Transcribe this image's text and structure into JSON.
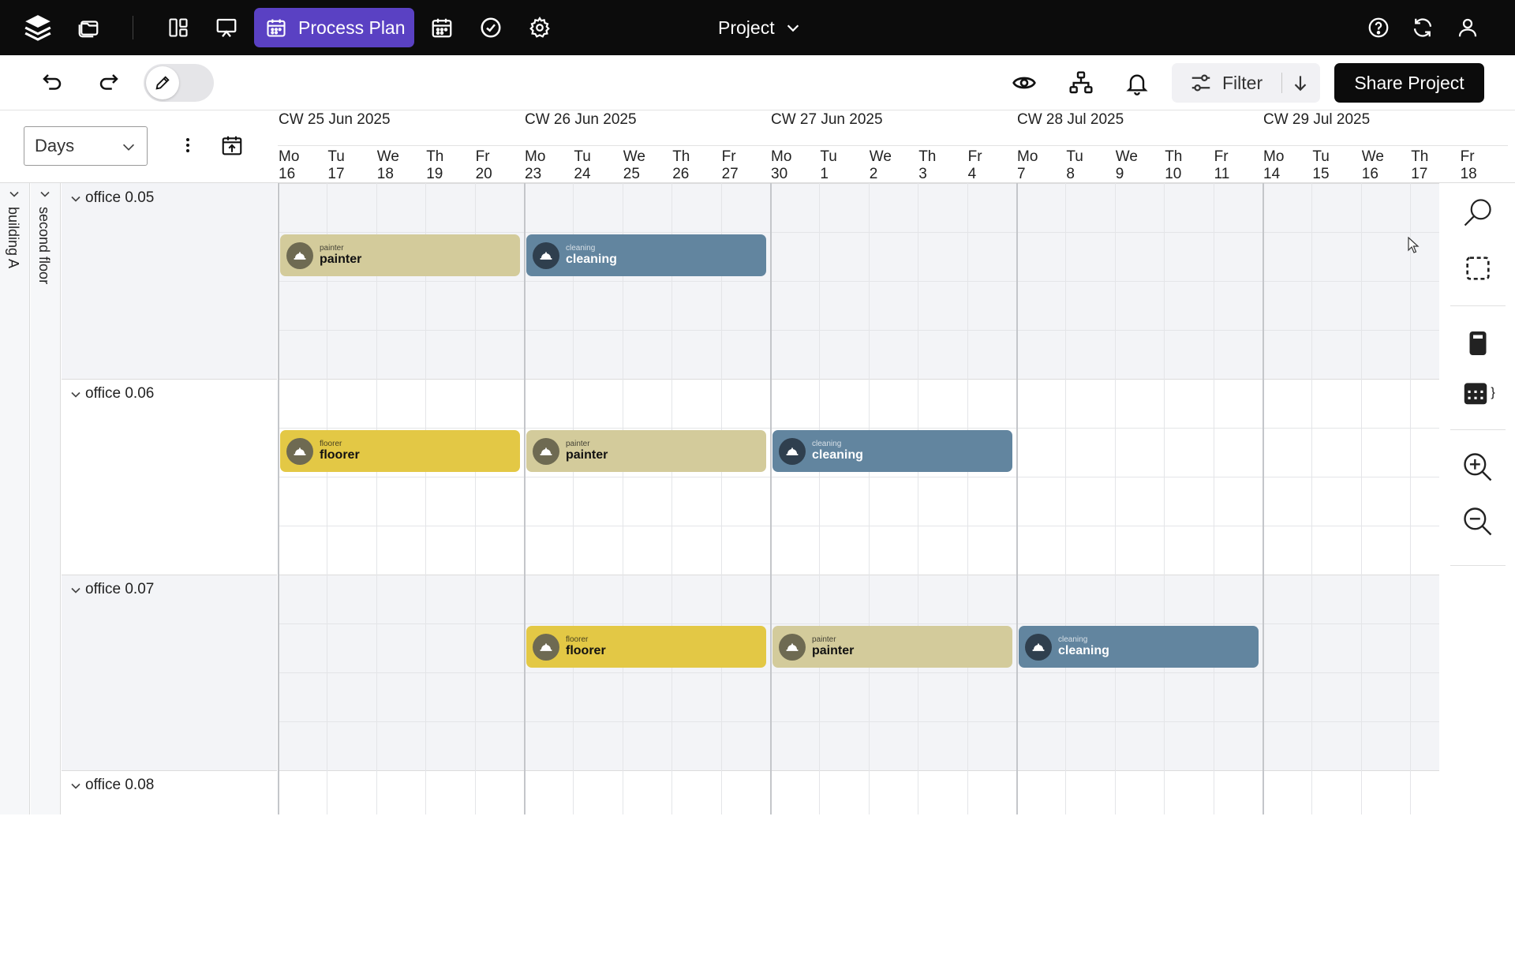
{
  "topbar": {
    "icons": [
      "layers-icon",
      "folder-icon",
      "dashboard-icon",
      "presentation-icon",
      "calendar-icon",
      "check-circle-icon",
      "gear-icon"
    ],
    "active_button": "Process Plan",
    "project_label": "Project",
    "right_icons": [
      "help-icon",
      "refresh-icon",
      "user-icon"
    ],
    "colors": {
      "bar": "#0c0c0c",
      "active": "#5a41c3"
    }
  },
  "toolbar": {
    "filter_label": "Filter",
    "share_label": "Share Project"
  },
  "view": {
    "scale_select": "Days"
  },
  "timeline": {
    "weeks": [
      "CW 25 Jun 2025",
      "CW 26 Jun 2025",
      "CW 27 Jun 2025",
      "CW 28 Jul 2025",
      "CW 29 Jul 2025"
    ],
    "days": [
      {
        "d": "Mo",
        "n": "16"
      },
      {
        "d": "Tu",
        "n": "17"
      },
      {
        "d": "We",
        "n": "18"
      },
      {
        "d": "Th",
        "n": "19"
      },
      {
        "d": "Fr",
        "n": "20"
      },
      {
        "d": "Mo",
        "n": "23"
      },
      {
        "d": "Tu",
        "n": "24"
      },
      {
        "d": "We",
        "n": "25"
      },
      {
        "d": "Th",
        "n": "26"
      },
      {
        "d": "Fr",
        "n": "27"
      },
      {
        "d": "Mo",
        "n": "30"
      },
      {
        "d": "Tu",
        "n": "1"
      },
      {
        "d": "We",
        "n": "2"
      },
      {
        "d": "Th",
        "n": "3"
      },
      {
        "d": "Fr",
        "n": "4"
      },
      {
        "d": "Mo",
        "n": "7"
      },
      {
        "d": "Tu",
        "n": "8"
      },
      {
        "d": "We",
        "n": "9"
      },
      {
        "d": "Th",
        "n": "10"
      },
      {
        "d": "Fr",
        "n": "11"
      },
      {
        "d": "Mo",
        "n": "14"
      },
      {
        "d": "Tu",
        "n": "15"
      },
      {
        "d": "We",
        "n": "16"
      },
      {
        "d": "Th",
        "n": "17"
      },
      {
        "d": "Fr",
        "n": "18"
      }
    ]
  },
  "hierarchy": {
    "building": "building A",
    "floor": "second floor"
  },
  "rooms": [
    "office 0.05",
    "office 0.06",
    "office 0.07",
    "office 0.08"
  ],
  "trade_colors": {
    "painter": "#d3cb9b",
    "cleaning": "#62859f",
    "floorer": "#e3c845"
  },
  "tasks": [
    {
      "room": 0,
      "week": 0,
      "trade": "painter",
      "small": "painter",
      "label": "painter"
    },
    {
      "room": 0,
      "week": 1,
      "trade": "cleaning",
      "small": "cleaning",
      "label": "cleaning"
    },
    {
      "room": 1,
      "week": 0,
      "trade": "floorer",
      "small": "floorer",
      "label": "floorer"
    },
    {
      "room": 1,
      "week": 1,
      "trade": "painter",
      "small": "painter",
      "label": "painter"
    },
    {
      "room": 1,
      "week": 2,
      "trade": "cleaning",
      "small": "cleaning",
      "label": "cleaning"
    },
    {
      "room": 2,
      "week": 1,
      "trade": "floorer",
      "small": "floorer",
      "label": "floorer"
    },
    {
      "room": 2,
      "week": 2,
      "trade": "painter",
      "small": "painter",
      "label": "painter"
    },
    {
      "room": 2,
      "week": 3,
      "trade": "cleaning",
      "small": "cleaning",
      "label": "cleaning"
    }
  ],
  "side_panel_icons": [
    "search-icon",
    "selection-icon",
    "calculator-icon",
    "calendar-grid-icon",
    "zoom-in-icon",
    "zoom-out-icon"
  ]
}
